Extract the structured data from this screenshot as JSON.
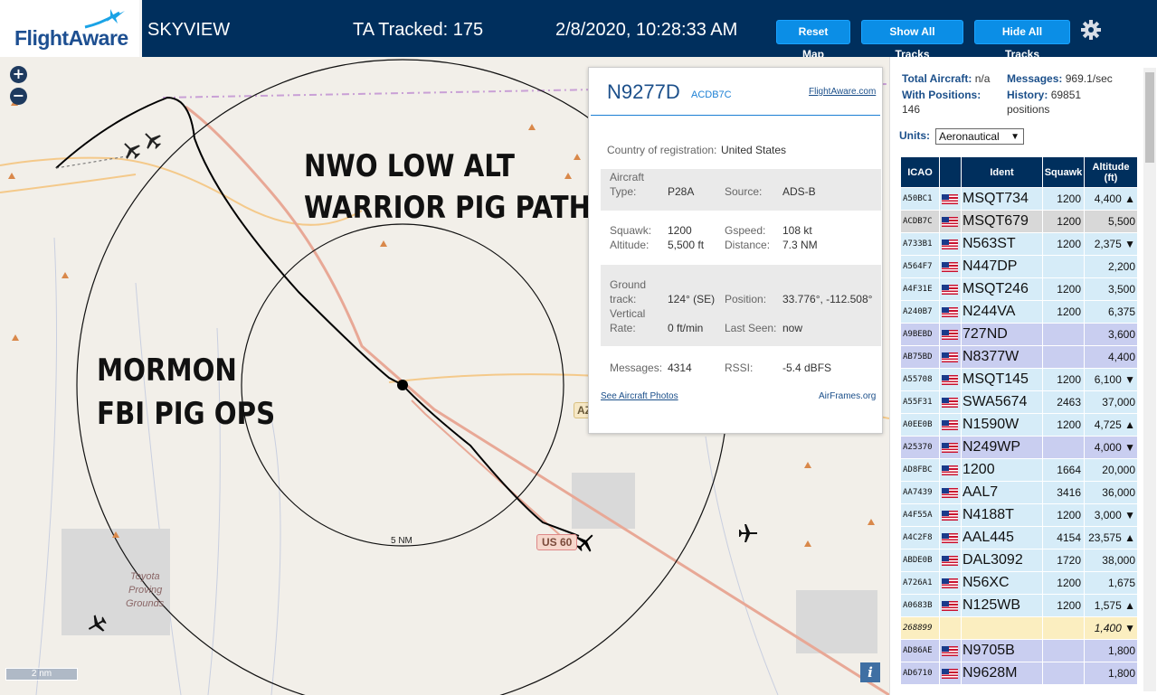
{
  "header": {
    "logo": "FlightAware",
    "app_name": "SKYVIEW",
    "tracked": "TA Tracked: 175",
    "datetime": "2/8/2020, 10:28:33 AM",
    "buttons": {
      "reset": "Reset Map",
      "show": "Show All Tracks",
      "hide": "Hide All Tracks"
    }
  },
  "map": {
    "annotation_1_line1": "NWO LOW ALT",
    "annotation_1_line2": "WARRIOR PIG PATH",
    "annotation_2_line1": "MORMON",
    "annotation_2_line2": "FBI PIG OPS",
    "ring_label": "5 NM",
    "scale_label": "2 nm",
    "road_us60": "US 60",
    "road_az": "AZ",
    "place_label_1": "Toyota",
    "place_label_2": "Proving",
    "place_label_3": "Grounds",
    "zoom_in": "+",
    "zoom_out": "−",
    "info": "i"
  },
  "popup": {
    "registration": "N9277D",
    "hex": "ACDB7C",
    "fa_link": "FlightAware.com",
    "country_label": "Country of registration:",
    "country": "United States",
    "aircraft_type_label_1": "Aircraft",
    "aircraft_type_label_2": "Type:",
    "aircraft_type": "P28A",
    "source_label": "Source:",
    "source": "ADS-B",
    "squawk_label": "Squawk:",
    "squawk": "1200",
    "gspeed_label": "Gspeed:",
    "gspeed": "108 kt",
    "altitude_label": "Altitude:",
    "altitude": "5,500 ft",
    "distance_label": "Distance:",
    "distance": "7.3 NM",
    "ground_label_1": "Ground",
    "ground_label_2": "track:",
    "ground_track": "124° (SE)",
    "position_label": "Position:",
    "position": "33.776°, -112.508°",
    "vrate_label_1": "Vertical",
    "vrate_label_2": "Rate:",
    "vrate": "0 ft/min",
    "lastseen_label": "Last Seen:",
    "lastseen": "now",
    "messages_label": "Messages:",
    "messages": "4314",
    "rssi_label": "RSSI:",
    "rssi": "-5.4 dBFS",
    "photos_link": "See Aircraft Photos",
    "airframes_link": "AirFrames.org"
  },
  "sidebar": {
    "total_label": "Total Aircraft:",
    "total": "n/a",
    "messages_label": "Messages:",
    "messages": "969.1/sec",
    "with_pos_label": "With Positions:",
    "with_pos": "146",
    "history_label": "History:",
    "history": "69851",
    "history_unit": "positions",
    "units_label": "Units:",
    "units_value": "Aeronautical",
    "columns": [
      "ICAO",
      "",
      "Ident",
      "Squawk",
      "Altitude (ft)"
    ],
    "rows": [
      {
        "icao": "A50BC1",
        "ident": "MSQT734",
        "squawk": "1200",
        "alt": "4,400 ▲",
        "bg": "#d6ecf8"
      },
      {
        "icao": "ACDB7C",
        "ident": "MSQT679",
        "squawk": "1200",
        "alt": "5,500",
        "bg": "#d8d8d8"
      },
      {
        "icao": "A733B1",
        "ident": "N563ST",
        "squawk": "1200",
        "alt": "2,375 ▼",
        "bg": "#d6ecf8"
      },
      {
        "icao": "A564F7",
        "ident": "N447DP",
        "squawk": "",
        "alt": "2,200",
        "bg": "#d6ecf8"
      },
      {
        "icao": "A4F31E",
        "ident": "MSQT246",
        "squawk": "1200",
        "alt": "3,500",
        "bg": "#d6ecf8"
      },
      {
        "icao": "A240B7",
        "ident": "N244VA",
        "squawk": "1200",
        "alt": "6,375",
        "bg": "#d6ecf8"
      },
      {
        "icao": "A9BEBD",
        "ident": "727ND",
        "squawk": "",
        "alt": "3,600",
        "bg": "#c9cef0"
      },
      {
        "icao": "AB75BD",
        "ident": "N8377W",
        "squawk": "",
        "alt": "4,400",
        "bg": "#c9cef0"
      },
      {
        "icao": "A55708",
        "ident": "MSQT145",
        "squawk": "1200",
        "alt": "6,100 ▼",
        "bg": "#d6ecf8"
      },
      {
        "icao": "A55F31",
        "ident": "SWA5674",
        "squawk": "2463",
        "alt": "37,000",
        "bg": "#d6ecf8"
      },
      {
        "icao": "A0EE0B",
        "ident": "N1590W",
        "squawk": "1200",
        "alt": "4,725 ▲",
        "bg": "#d6ecf8"
      },
      {
        "icao": "A25370",
        "ident": "N249WP",
        "squawk": "",
        "alt": "4,000 ▼",
        "bg": "#c9cef0"
      },
      {
        "icao": "AD8FBC",
        "ident": "1200",
        "squawk": "1664",
        "alt": "20,000",
        "bg": "#d6ecf8"
      },
      {
        "icao": "AA7439",
        "ident": "AAL7",
        "squawk": "3416",
        "alt": "36,000",
        "bg": "#d6ecf8"
      },
      {
        "icao": "A4F55A",
        "ident": "N4188T",
        "squawk": "1200",
        "alt": "3,000 ▼",
        "bg": "#d6ecf8"
      },
      {
        "icao": "A4C2F8",
        "ident": "AAL445",
        "squawk": "4154",
        "alt": "23,575 ▲",
        "bg": "#d6ecf8"
      },
      {
        "icao": "ABDE0B",
        "ident": "DAL3092",
        "squawk": "1720",
        "alt": "38,000",
        "bg": "#d6ecf8"
      },
      {
        "icao": "A726A1",
        "ident": "N56XC",
        "squawk": "1200",
        "alt": "1,675",
        "bg": "#d6ecf8"
      },
      {
        "icao": "A0683B",
        "ident": "N125WB",
        "squawk": "1200",
        "alt": "1,575 ▲",
        "bg": "#d6ecf8"
      },
      {
        "icao": "268899",
        "ident": "",
        "squawk": "",
        "alt": "1,400 ▼",
        "bg": "#fbeec0"
      },
      {
        "icao": "AD86AE",
        "ident": "N9705B",
        "squawk": "",
        "alt": "1,800",
        "bg": "#c9cef0"
      },
      {
        "icao": "AD6710",
        "ident": "N9628M",
        "squawk": "",
        "alt": "1,800",
        "bg": "#c9cef0"
      }
    ]
  }
}
